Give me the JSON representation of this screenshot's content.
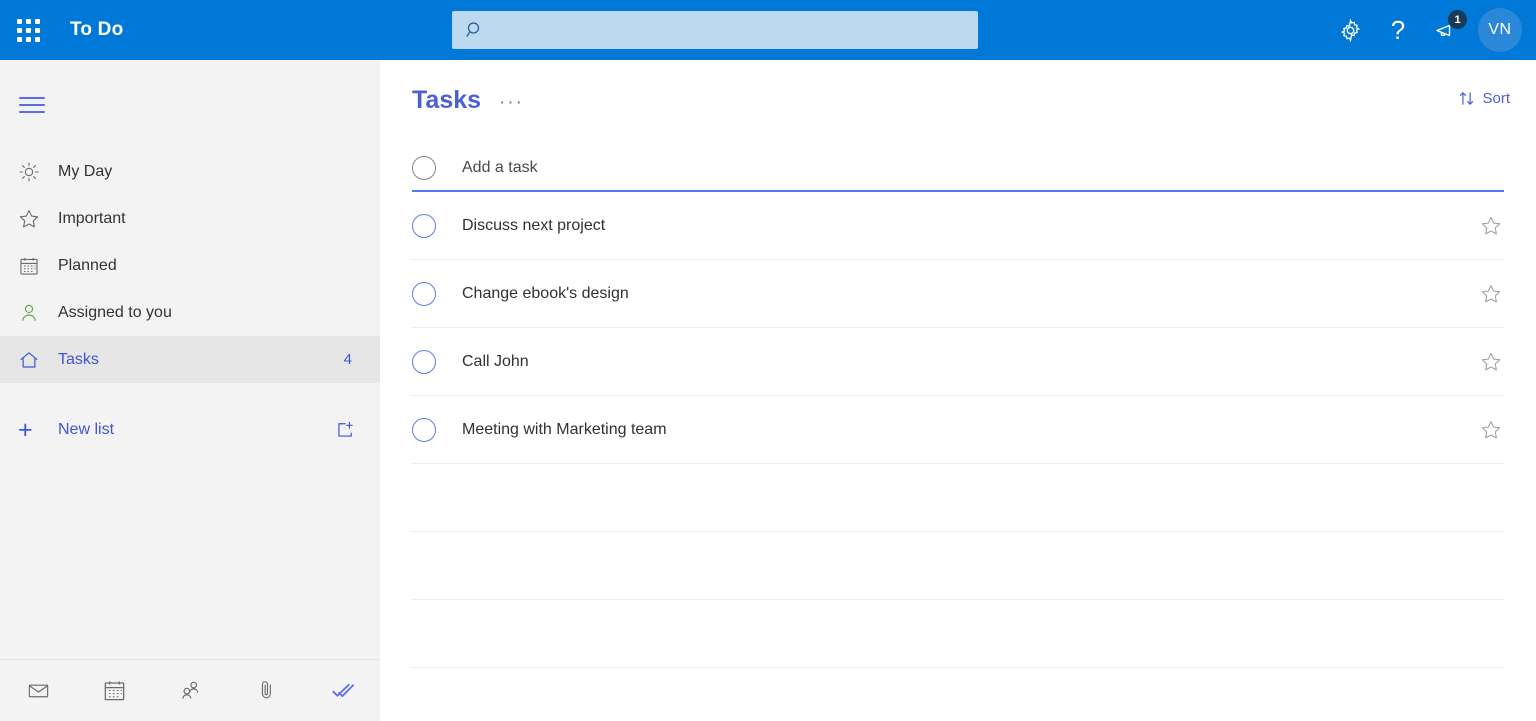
{
  "header": {
    "app_launcher": "app-launcher",
    "brand": "To Do",
    "search": {
      "value": "",
      "placeholder": ""
    },
    "settings_label": "Settings",
    "help_label": "?",
    "feedback_label": "Feedback",
    "notification_badge": "1",
    "avatar_initials": "VN"
  },
  "sidebar": {
    "menu_toggle": "Collapse navigation",
    "items": [
      {
        "label": "My Day",
        "icon": "sun-icon",
        "count": "",
        "active": false
      },
      {
        "label": "Important",
        "icon": "star-icon",
        "count": "",
        "active": false
      },
      {
        "label": "Planned",
        "icon": "calendar-icon",
        "count": "",
        "active": false
      },
      {
        "label": "Assigned to you",
        "icon": "person-icon",
        "count": "",
        "active": false
      },
      {
        "label": "Tasks",
        "icon": "home-icon",
        "count": "4",
        "active": true
      }
    ],
    "new_list_label": "New list",
    "new_group_label": "New group",
    "footer_apps": [
      {
        "name": "mail-icon",
        "label": "Mail"
      },
      {
        "name": "calendar-icon",
        "label": "Calendar"
      },
      {
        "name": "people-icon",
        "label": "People"
      },
      {
        "name": "files-icon",
        "label": "Files"
      },
      {
        "name": "todo-icon",
        "label": "To Do"
      }
    ]
  },
  "main": {
    "title": "Tasks",
    "more_options": "···",
    "sort_label": "Sort",
    "add_task_placeholder": "Add a task",
    "add_task_value": "",
    "tasks": [
      {
        "title": "Discuss next project",
        "completed": false,
        "important": false
      },
      {
        "title": "Change ebook's design",
        "completed": false,
        "important": false
      },
      {
        "title": "Call John",
        "completed": false,
        "important": false
      },
      {
        "title": "Meeting with Marketing team",
        "completed": false,
        "important": false
      }
    ],
    "empty_rows": 3
  },
  "colors": {
    "header_blue": "#0078d7",
    "search_bg": "#bcd9f0",
    "sidebar_bg": "#f3f3f3",
    "accent_indigo": "#4c5fd7",
    "avatar_bg": "#2b88d8",
    "badge_bg": "#1b3a57"
  }
}
